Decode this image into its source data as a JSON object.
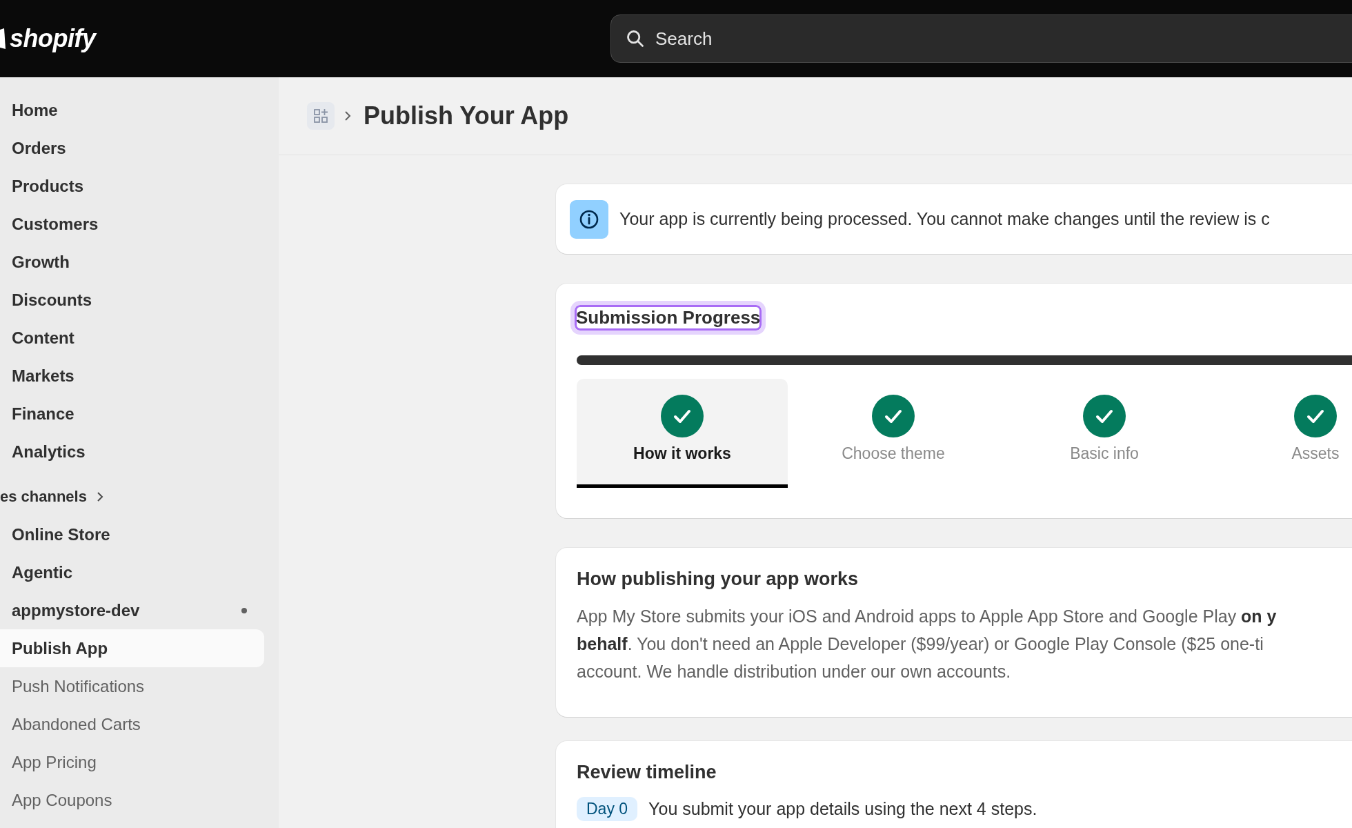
{
  "top_bar": {
    "logo": "shopify",
    "search": {
      "placeholder": "Search"
    }
  },
  "sidebar": {
    "items": [
      {
        "label": "Home",
        "kind": "main",
        "selected": false
      },
      {
        "label": "Orders",
        "kind": "main",
        "selected": false
      },
      {
        "label": "Products",
        "kind": "main",
        "selected": false
      },
      {
        "label": "Customers",
        "kind": "main",
        "selected": false
      },
      {
        "label": "Growth",
        "kind": "main",
        "selected": false
      },
      {
        "label": "Discounts",
        "kind": "main",
        "selected": false
      },
      {
        "label": "Content",
        "kind": "main",
        "selected": false
      },
      {
        "label": "Markets",
        "kind": "main",
        "selected": false
      },
      {
        "label": "Finance",
        "kind": "main",
        "selected": false
      },
      {
        "label": "Analytics",
        "kind": "main",
        "selected": false
      },
      {
        "label": "es channels",
        "kind": "section"
      },
      {
        "label": "Online Store",
        "kind": "main",
        "selected": false
      },
      {
        "label": "Agentic",
        "kind": "main",
        "selected": false
      },
      {
        "label": "appmystore-dev",
        "kind": "app",
        "selected": false
      },
      {
        "label": "Publish App",
        "kind": "sub",
        "selected": true
      },
      {
        "label": "Push Notifications",
        "kind": "sub",
        "selected": false
      },
      {
        "label": "Abandoned Carts",
        "kind": "sub",
        "selected": false
      },
      {
        "label": "App Pricing",
        "kind": "sub",
        "selected": false
      },
      {
        "label": "App Coupons",
        "kind": "sub",
        "selected": false
      }
    ]
  },
  "header": {
    "title": "Publish Your App"
  },
  "banner": {
    "text": "Your app is currently being processed. You cannot make changes until the review is c"
  },
  "progress": {
    "title": "Submission Progress",
    "focused": true,
    "level": 1,
    "steps": [
      {
        "label": "How it works",
        "selected": true,
        "done": true
      },
      {
        "label": "Choose theme",
        "selected": false,
        "done": true
      },
      {
        "label": "Basic info",
        "selected": false,
        "done": true
      },
      {
        "label": "Assets",
        "selected": false,
        "done": true
      }
    ]
  },
  "how": {
    "title": "How publishing your app works",
    "lines": [
      "App My Store submits your iOS and Android apps to Apple App Store and Google Play **on y**",
      "**behalf**. You don't need an Apple Developer ($99/year) or Google Play Console ($25 one-ti",
      "account. We handle distribution under our own accounts."
    ]
  },
  "review": {
    "title": "Review timeline",
    "entries": [
      {
        "badge": "Day 0",
        "text": "You submit your app details using the next 4 steps."
      }
    ]
  }
}
